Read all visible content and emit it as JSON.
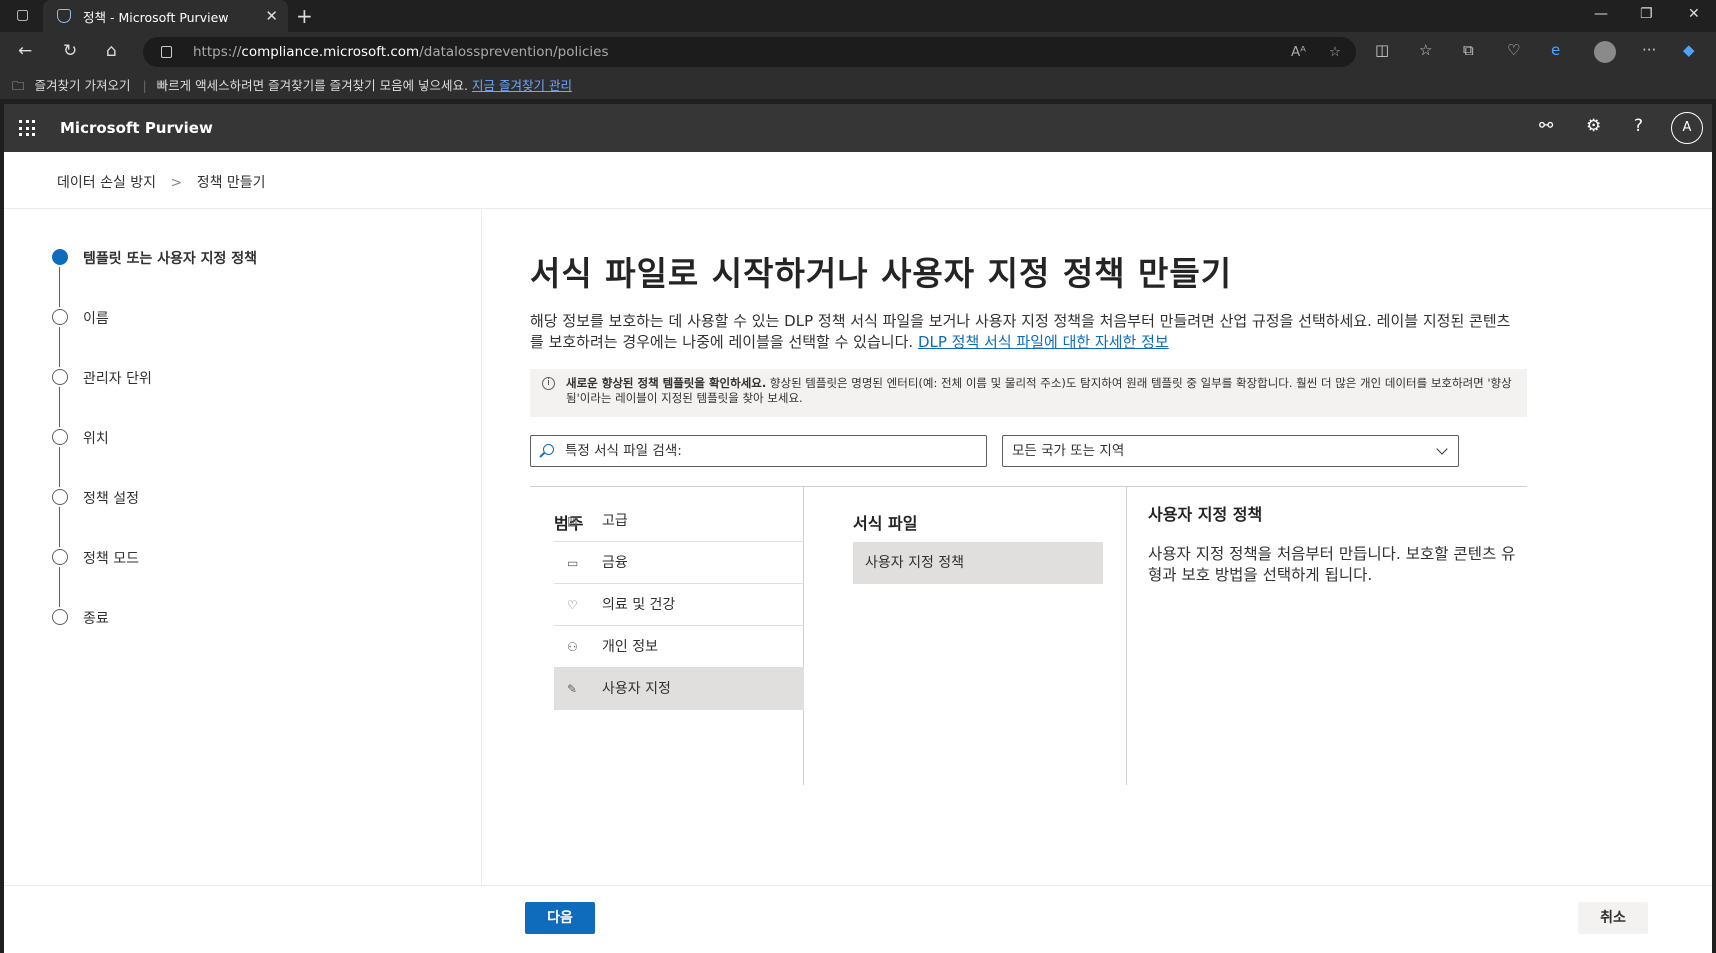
{
  "browser": {
    "tab_title": "정책 - Microsoft Purview",
    "url_prefix": "https://",
    "url_host": "compliance.microsoft.com",
    "url_path": "/datalossprevention/policies",
    "fav_import": "즐겨찾기 가져오기",
    "fav_msg": "빠르게 액세스하려면 즐겨찾기를 즐겨찾기 모음에 넣으세요.",
    "fav_link": "지금 즐겨찾기 관리"
  },
  "header": {
    "brand": "Microsoft Purview",
    "avatar": "A"
  },
  "breadcrumb": {
    "item1": "데이터 손실 방지",
    "sep": ">",
    "item2": "정책 만들기"
  },
  "steps": [
    {
      "label": "템플릿 또는 사용자 지정 정책"
    },
    {
      "label": "이름"
    },
    {
      "label": "관리자 단위"
    },
    {
      "label": "위치"
    },
    {
      "label": "정책 설정"
    },
    {
      "label": "정책 모드"
    },
    {
      "label": "종료"
    }
  ],
  "main": {
    "title": "서식 파일로 시작하거나 사용자 지정 정책 만들기",
    "intro": "해당 정보를 보호하는 데 사용할 수 있는 DLP 정책 서식 파일을 보거나 사용자 지정 정책을 처음부터 만들려면 산업 규정을 선택하세요. 레이블 지정된 콘텐츠를 보호하려는 경우에는 나중에 레이블을 선택할 수 있습니다.",
    "intro_link": "DLP 정책 서식 파일에 대한 자세한 정보",
    "notice_bold": "새로운 향상된 정책 템플릿을 확인하세요.",
    "notice_text": "향상된 템플릿은 명명된 엔터티(예: 전체 이름 및 물리적 주소)도 탐지하여 원래 템플릿 중 일부를 확장합니다. 훨씬 더 많은 개인 데이터를 보호하려면 '향상됨'이라는 레이블이 지정된 템플릿을 찾아 보세요.",
    "search_placeholder": "특정 서식 파일 검색:",
    "region_select": "모든 국가 또는 지역",
    "col_category": "범주",
    "col_templates": "서식 파일",
    "categories": [
      {
        "label": "고급",
        "icon": "library-icon"
      },
      {
        "label": "금융",
        "icon": "card-icon"
      },
      {
        "label": "의료 및 건강",
        "icon": "heart-icon"
      },
      {
        "label": "개인 정보",
        "icon": "person-icon"
      },
      {
        "label": "사용자 지정",
        "icon": "wrench-icon"
      }
    ],
    "template_item": "사용자 지정 정책",
    "detail_title": "사용자 지정 정책",
    "detail_text": "사용자 지정 정책을 처음부터 만듭니다. 보호할 콘텐츠 유형과 보호 방법을 선택하게 됩니다."
  },
  "footer": {
    "next": "다음",
    "cancel": "취소"
  }
}
